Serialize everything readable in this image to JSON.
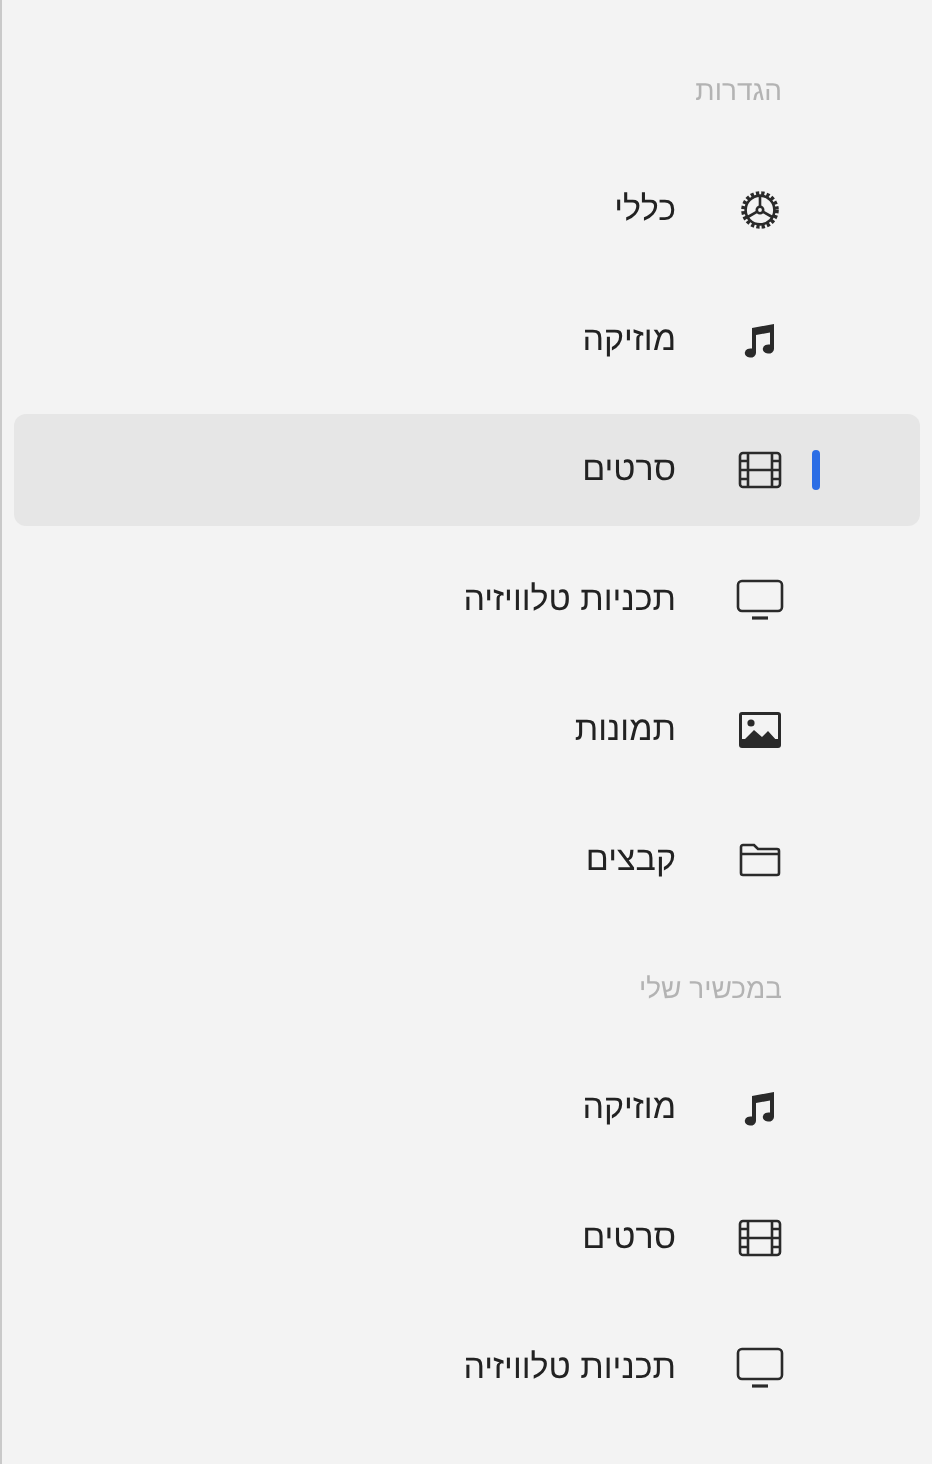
{
  "sections": [
    {
      "title": "הגדרות",
      "items": [
        {
          "label": "כללי",
          "kind": "general",
          "selected": false
        },
        {
          "label": "מוזיקה",
          "kind": "music",
          "selected": false
        },
        {
          "label": "סרטים",
          "kind": "movies",
          "selected": true
        },
        {
          "label": "תכניות טלוויזיה",
          "kind": "tv",
          "selected": false
        },
        {
          "label": "תמונות",
          "kind": "photos",
          "selected": false
        },
        {
          "label": "קבצים",
          "kind": "files",
          "selected": false
        }
      ]
    },
    {
      "title": "במכשיר שלי",
      "items": [
        {
          "label": "מוזיקה",
          "kind": "music",
          "selected": false
        },
        {
          "label": "סרטים",
          "kind": "movies",
          "selected": false
        },
        {
          "label": "תכניות טלוויזיה",
          "kind": "tv",
          "selected": false
        }
      ]
    }
  ]
}
